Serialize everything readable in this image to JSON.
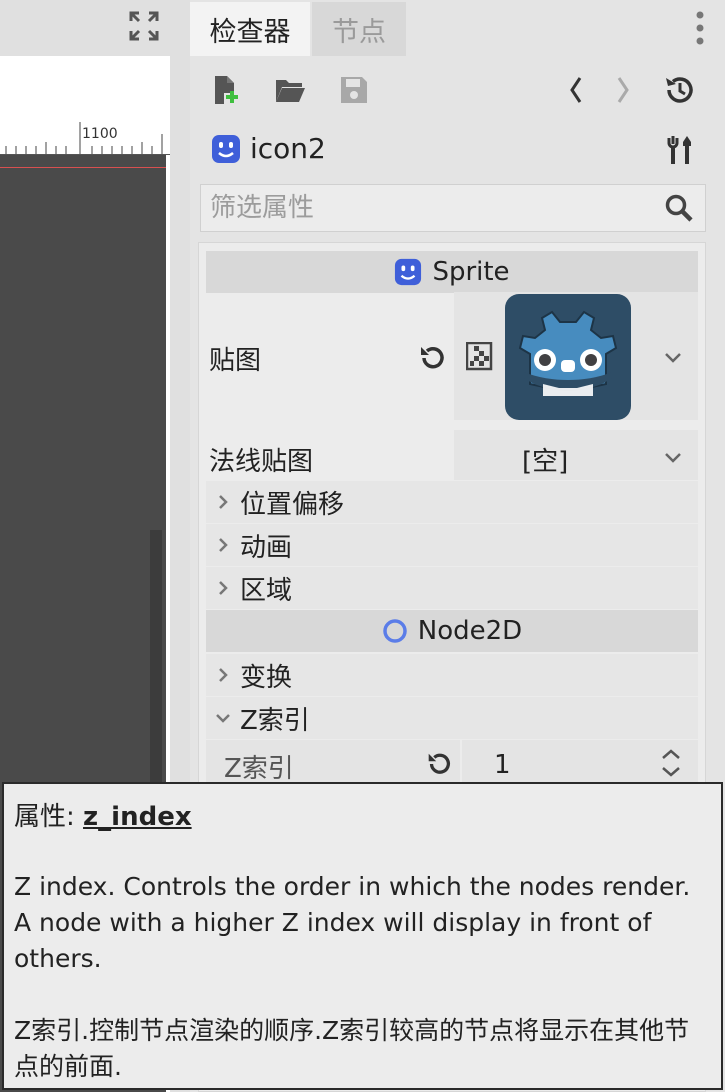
{
  "inspector": {
    "tabs": [
      "检查器",
      "节点"
    ],
    "object_name": "icon2",
    "filter_placeholder": "筛选属性"
  },
  "viewport": {
    "ruler_label": "1100"
  },
  "sprite_section": {
    "header": "Sprite",
    "texture_label": "贴图",
    "normal_map_label": "法线贴图",
    "normal_map_value": "[空]",
    "groups": [
      "位置偏移",
      "动画",
      "区域"
    ]
  },
  "node2d_section": {
    "header": "Node2D",
    "groups": [
      "变换",
      "Z索引"
    ],
    "z_index_label": "Z索引",
    "z_index_value": "1"
  },
  "tooltip": {
    "prefix": "属性: ",
    "property": "z_index",
    "desc_en": "Z index. Controls the order in which the nodes render. A node with a higher Z index will display in front of others.",
    "desc_zh": "Z索引.控制节点渲染的顺序.Z索引较高的节点将显示在其他节点的前面."
  },
  "colors": {
    "godot_blue": "#478cbf",
    "godot_dark": "#2e4d66",
    "node2d_blue": "#5b7de8",
    "object_icon_blue": "#3f5fd9",
    "new_green": "#3fbf3f"
  }
}
